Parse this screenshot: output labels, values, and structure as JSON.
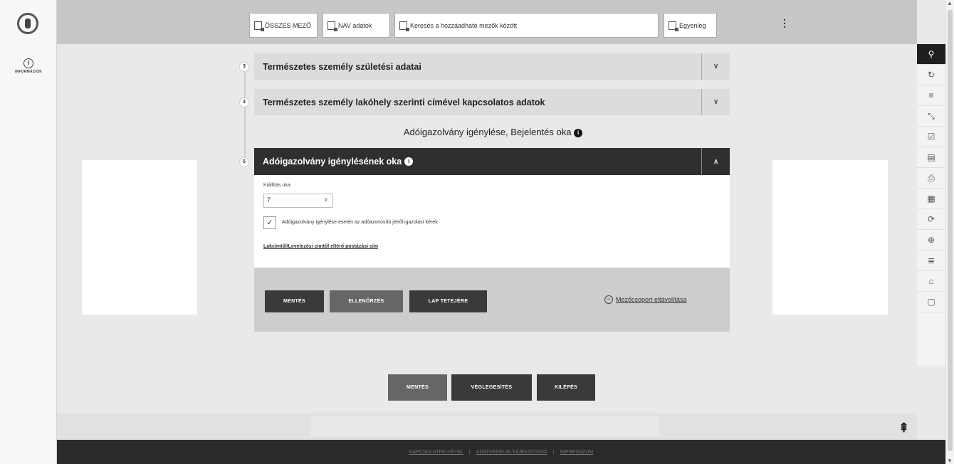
{
  "left_rail": {
    "info_label": "INFORMÁCIÓK"
  },
  "topbar": {
    "all_fields": "ÖSSZES MEZŐ",
    "nav_data": "NAV adatok",
    "search_placeholder": "Keresés a hozzáadható mezők között",
    "balance": "Egyenleg"
  },
  "sections": [
    {
      "num": "3",
      "title": "Természetes személy születési adatai"
    },
    {
      "num": "4",
      "title": "Természetes személy lakóhely szerinti címével kapcsolatos adatok"
    }
  ],
  "group_title": "Adóigazolvány igénylése, Bejelentés oka",
  "active_section": {
    "num": "5",
    "title": "Adóigazolvány igénylésének oka",
    "field_label": "Kiállítás oka",
    "field_value": "7",
    "checkbox_label": "Adóigazolvány igénylése esetén az adóazonosító jelről igazolást kérek",
    "checkbox_mark": "✓",
    "link": "Lakcímtől/Levelezési címtől eltérő postázási cím"
  },
  "section_buttons": {
    "save": "MENTÉS",
    "check": "ELLENŐRZÉS",
    "top": "LAP TETEJÉRE",
    "remove": "Mezőcsoport eltávolítása"
  },
  "bottom_buttons": {
    "save": "MENTÉS",
    "finalize": "VÉGLEGESÍTÉS",
    "exit": "KILÉPÉS"
  },
  "footer": {
    "contact": "KAPCSOLATFELVÉTEL",
    "privacy": "ADATVÉDELMI TÁJÉKOZTATÓ",
    "imprint": "IMPRESSZUM",
    "sep": "|"
  },
  "right_rail_icons": [
    "search-icon",
    "undo-icon",
    "list-icon",
    "collapse-icon",
    "checklist-icon",
    "document-icon",
    "print-icon",
    "form-icon",
    "refresh-doc-icon",
    "new-doc-icon",
    "list-icon",
    "archive-icon",
    "file-info-icon"
  ],
  "colors": {
    "topbar": "#c7c7c7",
    "active_header": "#2f2f2f",
    "button_dark": "#3a3a3a",
    "button_gray": "#666666",
    "footer": "#2a2a2a"
  }
}
